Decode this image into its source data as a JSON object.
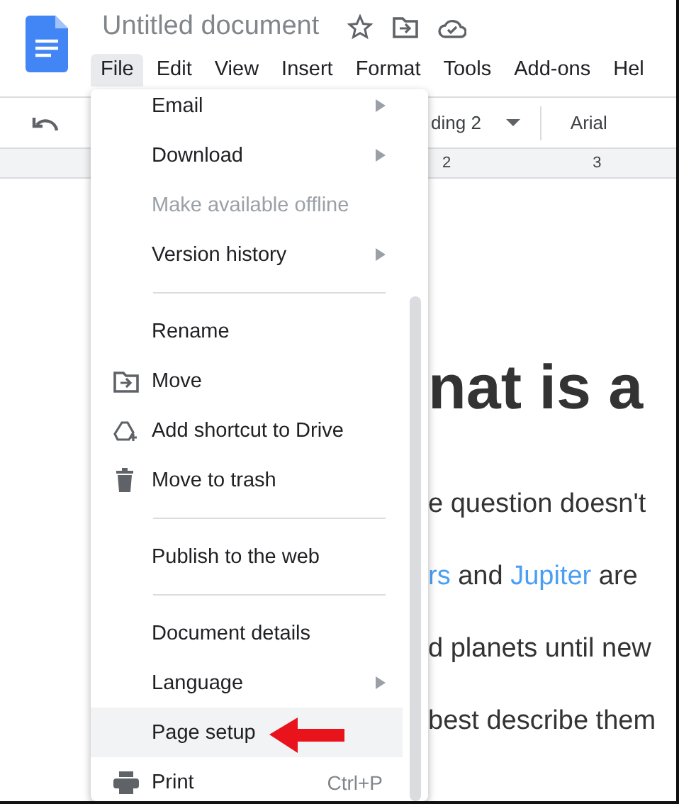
{
  "document_title": "Untitled document",
  "menu_bar": [
    {
      "label": "File",
      "selected": true
    },
    {
      "label": "Edit",
      "selected": false
    },
    {
      "label": "View",
      "selected": false
    },
    {
      "label": "Insert",
      "selected": false
    },
    {
      "label": "Format",
      "selected": false
    },
    {
      "label": "Tools",
      "selected": false
    },
    {
      "label": "Add-ons",
      "selected": false
    },
    {
      "label": "Hel",
      "selected": false
    }
  ],
  "toolbar": {
    "style": "ding 2",
    "font": "Arial"
  },
  "ruler": [
    "2",
    "3"
  ],
  "document": {
    "heading": "nat is a",
    "lines": [
      [
        {
          "text": "e question doesn't",
          "link": false
        }
      ],
      [
        {
          "text": "rs",
          "link": true
        },
        {
          "text": " and ",
          "link": false
        },
        {
          "text": "Jupiter",
          "link": true
        },
        {
          "text": " are",
          "link": false
        }
      ],
      [
        {
          "text": "d planets until new",
          "link": false
        }
      ],
      [
        {
          "text": "best describe them",
          "link": false
        }
      ]
    ]
  },
  "file_menu": [
    {
      "kind": "item",
      "label": "Email",
      "disabled": false,
      "submenu": true,
      "selected": false
    },
    {
      "kind": "item",
      "label": "Download",
      "disabled": false,
      "submenu": true,
      "selected": false
    },
    {
      "kind": "item",
      "label": "Make available offline",
      "disabled": true,
      "submenu": false,
      "selected": false
    },
    {
      "kind": "item",
      "label": "Version history",
      "disabled": false,
      "submenu": true,
      "selected": false
    },
    {
      "kind": "divider"
    },
    {
      "kind": "item",
      "label": "Rename",
      "disabled": false,
      "submenu": false,
      "selected": false
    },
    {
      "kind": "item",
      "label": "Move",
      "disabled": false,
      "submenu": false,
      "selected": false
    },
    {
      "kind": "item",
      "label": "Add shortcut to Drive",
      "disabled": false,
      "submenu": false,
      "selected": false
    },
    {
      "kind": "item",
      "label": "Move to trash",
      "disabled": false,
      "submenu": false,
      "selected": false
    },
    {
      "kind": "divider"
    },
    {
      "kind": "item",
      "label": "Publish to the web",
      "disabled": false,
      "submenu": false,
      "selected": false
    },
    {
      "kind": "divider"
    },
    {
      "kind": "item",
      "label": "Document details",
      "disabled": false,
      "submenu": false,
      "selected": false
    },
    {
      "kind": "item",
      "label": "Language",
      "disabled": false,
      "submenu": true,
      "selected": false
    },
    {
      "kind": "item",
      "label": "Page setup",
      "disabled": false,
      "submenu": false,
      "selected": true
    },
    {
      "kind": "item",
      "label": "Print",
      "disabled": false,
      "submenu": false,
      "selected": false,
      "shortcut": "Ctrl+P"
    }
  ]
}
